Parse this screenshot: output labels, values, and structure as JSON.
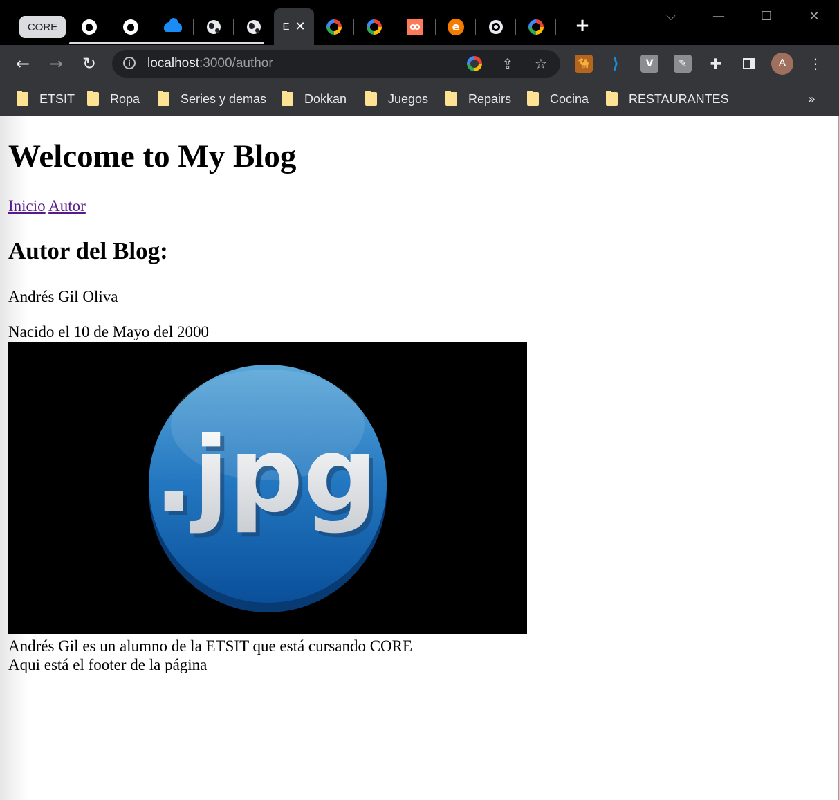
{
  "browser": {
    "tab_group_label": "CORE",
    "active_tab_title": "E",
    "tab_icons": [
      "github-icon",
      "github-icon",
      "onedrive-icon",
      "globe-icon",
      "globe-icon",
      "google-icon",
      "google-icon",
      "hubspot-icon",
      "e-icon",
      "chrome-icon",
      "google-icon"
    ],
    "url_host": "localhost",
    "url_path": ":3000/author",
    "profile_initial": "A",
    "extensions": [
      "ext-camel-icon",
      "vscode-icon",
      "ext-v-icon",
      "ext-tool-icon",
      "extensions-puzzle-icon",
      "side-panel-icon"
    ],
    "bookmarks": [
      "ETSIT",
      "Ropa",
      "Series y demas",
      "Dokkan",
      "Juegos",
      "Repairs",
      "Cocina",
      "RESTAURANTES"
    ],
    "bookmarks_more": "»",
    "accent_color": "#1b8bf5"
  },
  "page": {
    "title": "Welcome to My Blog",
    "nav": {
      "home": "Inicio",
      "author": "Autor"
    },
    "author_heading": "Autor del Blog:",
    "author_name": "Andrés Gil Oliva",
    "birth": "Nacido el 10 de Mayo del 2000",
    "image_label": ".jpg",
    "description": "Andrés Gil es un alumno de la ETSIT que está cursando CORE",
    "footer": "Aqui está el footer de la página"
  }
}
